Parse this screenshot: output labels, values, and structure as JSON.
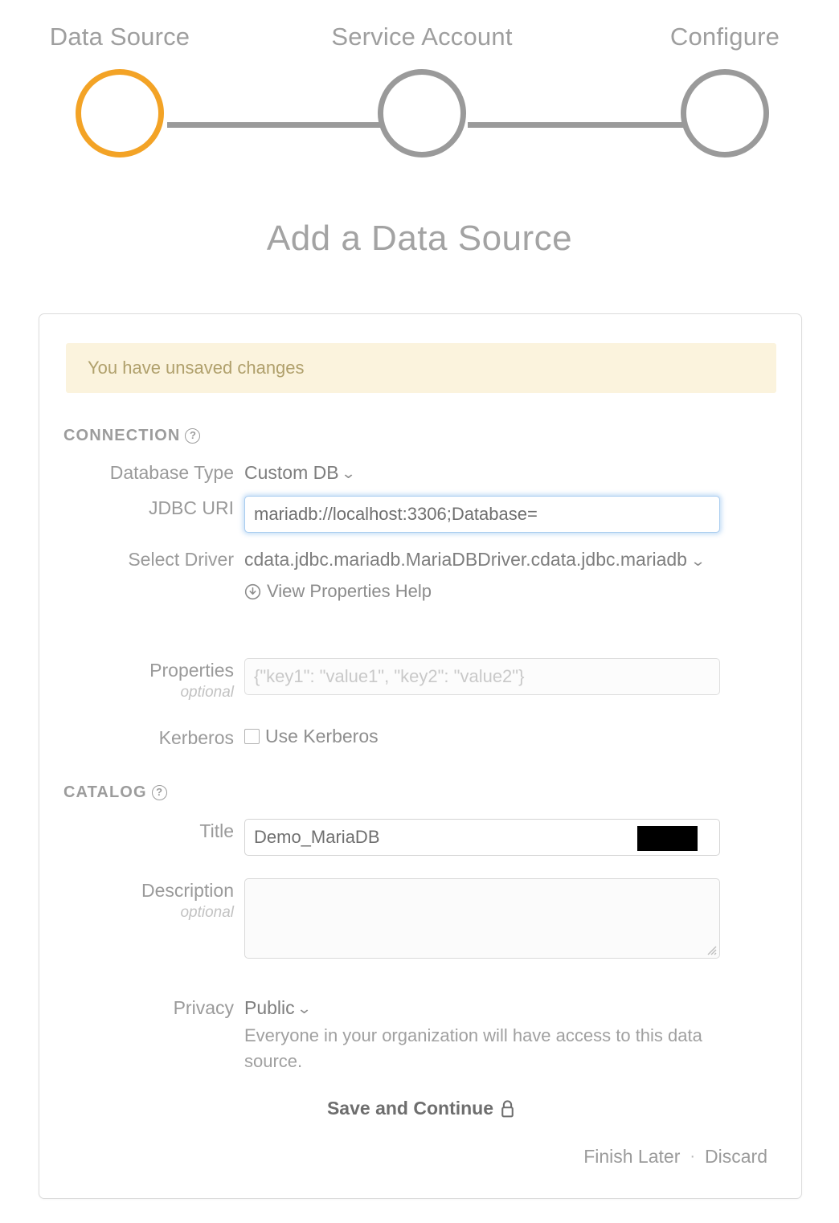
{
  "stepper": {
    "steps": [
      {
        "label": "Data Source",
        "state": "active",
        "circle_color": "#f3a326"
      },
      {
        "label": "Service Account",
        "state": "inactive",
        "circle_color": "#9a9a9a"
      },
      {
        "label": "Configure",
        "state": "inactive",
        "circle_color": "#9a9a9a"
      }
    ],
    "connector_color": "#9a9a9a"
  },
  "page": {
    "title": "Add a Data Source"
  },
  "alert": {
    "message": "You have unsaved changes",
    "background": "#fbf3dd",
    "text_color": "#b0a06c"
  },
  "connection": {
    "section_title": "CONNECTION",
    "help_icon": "question-circle-icon",
    "database_type": {
      "label": "Database Type",
      "value": "Custom DB",
      "chevron": "chevron-down-icon"
    },
    "jdbc_uri": {
      "label": "JDBC URI",
      "value": "mariadb://localhost:3306;Database=",
      "redacted": true,
      "focused": true,
      "focus_ring_color": "#a9cdf0"
    },
    "select_driver": {
      "label": "Select Driver",
      "value": "cdata.jdbc.mariadb.MariaDBDriver.cdata.jdbc.mariadb",
      "chevron": "chevron-down-icon",
      "help_link": "View Properties Help",
      "help_link_icon": "download-circle-icon"
    },
    "properties": {
      "label": "Properties",
      "optional": "optional",
      "value": "",
      "placeholder": "{\"key1\": \"value1\", \"key2\": \"value2\"}"
    },
    "kerberos": {
      "label": "Kerberos",
      "checkbox_label": "Use Kerberos",
      "checked": false
    }
  },
  "catalog": {
    "section_title": "CATALOG",
    "help_icon": "question-circle-icon",
    "title_field": {
      "label": "Title",
      "value": "Demo_MariaDB",
      "placeholder": ""
    },
    "description_field": {
      "label": "Description",
      "optional": "optional",
      "value": "",
      "placeholder": ""
    },
    "privacy": {
      "label": "Privacy",
      "value": "Public",
      "chevron": "chevron-down-icon",
      "description": "Everyone in your organization will have access to this data source."
    }
  },
  "actions": {
    "save_label": "Save and Continue",
    "save_icon": "lock-icon",
    "finish_later_label": "Finish Later",
    "separator": "·",
    "discard_label": "Discard"
  }
}
